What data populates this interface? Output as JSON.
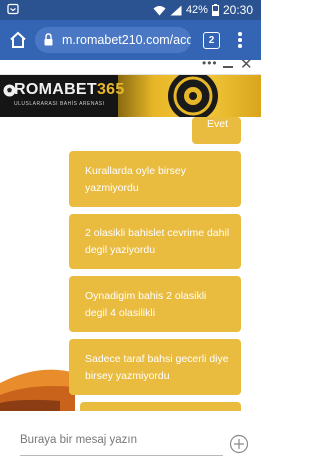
{
  "status_bar": {
    "battery_percent": "42%",
    "time": "20:30",
    "icons": [
      "wifi-icon",
      "signal-icon",
      "battery-icon"
    ]
  },
  "browser": {
    "url": "m.romabet210.com/acc",
    "tab_count": "2"
  },
  "banner": {
    "brand": "ROMABET",
    "brand_number": "365",
    "tagline": "ULUSLARARASI BAHİS ARENASI"
  },
  "messages": [
    {
      "text": "Evet"
    },
    {
      "text": "Kurallarda oyle birsey yazmiyordu"
    },
    {
      "text": "2 olasikli bahislet cevrime dahil degil yaziyordu"
    },
    {
      "text": "Oynadigim bahis 2 olasikli degil 4 olasilikli"
    },
    {
      "text": "Sadece taraf bahsi gecerli diye birsey yazmiyordu"
    },
    {
      "text": ""
    }
  ],
  "composer": {
    "placeholder": "Buraya bir mesaj yazın"
  },
  "colors": {
    "status_bar": "#2c5391",
    "browser_bar": "#3465b5",
    "bubble": "#e9bb3f"
  }
}
